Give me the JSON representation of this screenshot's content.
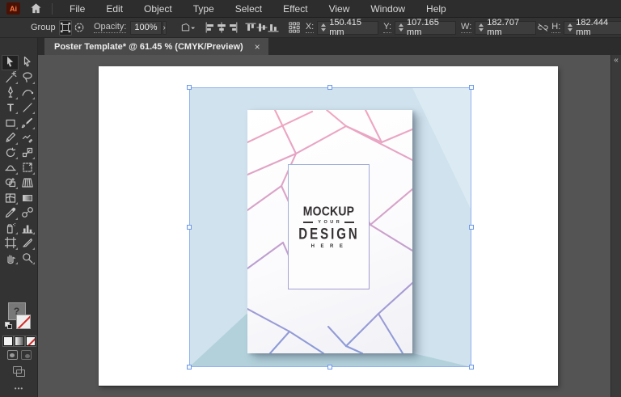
{
  "window": {
    "tab_title": "Poster Template* @ 61.45 % (CMYK/Preview)",
    "close_glyph": "×",
    "dock_collapse_glyph": "«"
  },
  "menu_bar": {
    "logo_text": "Ai",
    "items": [
      "File",
      "Edit",
      "Object",
      "Type",
      "Select",
      "Effect",
      "View",
      "Window",
      "Help"
    ]
  },
  "control_bar": {
    "selection_type": "Group",
    "opacity_label": "Opacity:",
    "opacity_value": "100%",
    "opacity_menu_glyph": "›",
    "x_label": "X:",
    "x_value": "150.415 mm",
    "y_label": "Y:",
    "y_value": "107.165 mm",
    "w_label": "W:",
    "w_value": "182.707 mm",
    "h_label": "H:",
    "h_value": "182.444 mm"
  },
  "toolbar": {
    "rows": [
      [
        "selection-tool",
        "direct-selection-tool"
      ],
      [
        "magic-wand-tool",
        "lasso-tool"
      ],
      [
        "pen-tool",
        "curvature-tool"
      ],
      [
        "type-tool",
        "line-segment-tool"
      ],
      [
        "rectangle-tool",
        "paintbrush-tool"
      ],
      [
        "pencil-tool",
        "shaper-tool"
      ],
      [
        "rotate-tool",
        "scale-tool"
      ],
      [
        "width-tool",
        "free-transform-tool"
      ],
      [
        "shape-builder-tool",
        "perspective-grid-tool"
      ],
      [
        "mesh-tool",
        "gradient-tool"
      ],
      [
        "eyedropper-tool",
        "blend-tool"
      ],
      [
        "symbol-sprayer-tool",
        "graph-tool"
      ],
      [
        "artboard-tool",
        "slice-tool"
      ],
      [
        "hand-tool",
        "zoom-tool"
      ]
    ],
    "active_tool": "selection-tool",
    "fill_indicator": "?",
    "more_glyph": "•••"
  },
  "artboard": {
    "poster": {
      "title": "MOCKUP",
      "subtitle": "YOUR",
      "design": "DESIGN",
      "here": "HERE"
    }
  },
  "colors": {
    "selection_blue": "#90b2ef",
    "square_base": "#cfe2ed",
    "square_highlight": "#dcebf3",
    "square_shadow": "#b2d1db",
    "pattern_pink": "#f1a6c0",
    "pattern_purple": "#8a9bd8",
    "logo_orange": "#ff7a45"
  }
}
